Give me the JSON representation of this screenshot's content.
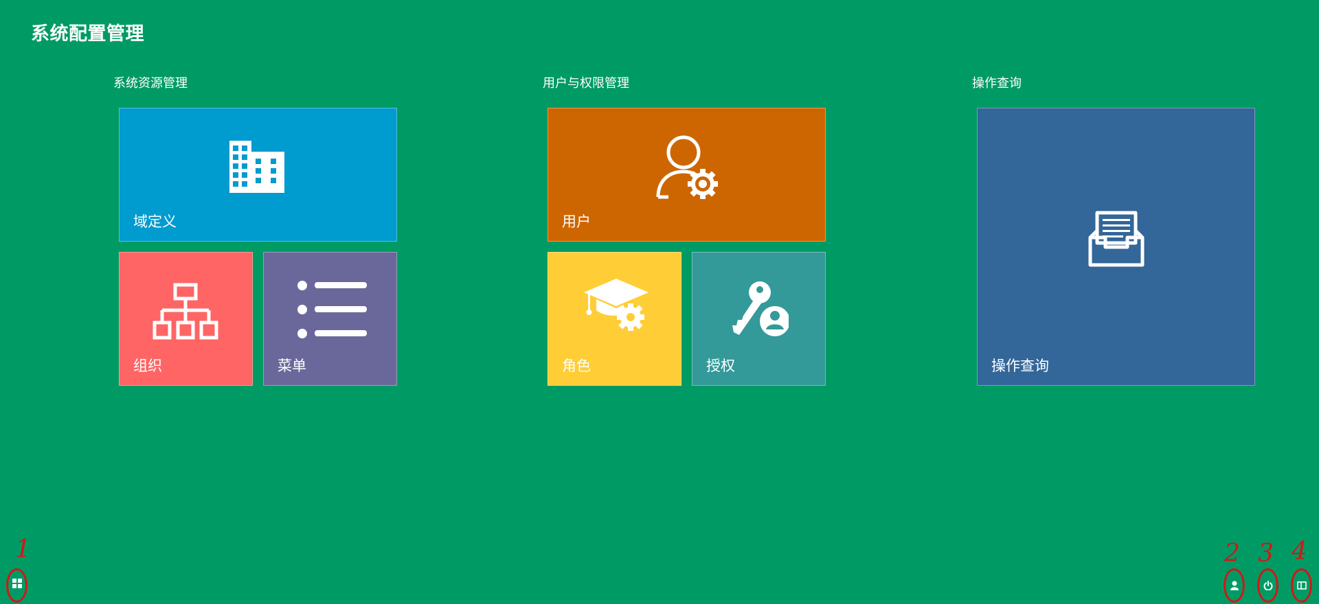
{
  "page": {
    "title": "系统配置管理",
    "background_color": "#009b64"
  },
  "groups": [
    {
      "title": "系统资源管理",
      "tiles": [
        {
          "label": "域定义",
          "icon": "building-icon",
          "color": "#009bcf"
        },
        {
          "label": "组织",
          "icon": "org-chart-icon",
          "color": "#ff6565"
        },
        {
          "label": "菜单",
          "icon": "list-icon",
          "color": "#6a689a"
        }
      ]
    },
    {
      "title": "用户与权限管理",
      "tiles": [
        {
          "label": "用户",
          "icon": "user-settings-icon",
          "color": "#cd6600"
        },
        {
          "label": "角色",
          "icon": "graduation-cap-gear-icon",
          "color": "#ffcd35"
        },
        {
          "label": "授权",
          "icon": "key-user-icon",
          "color": "#339999"
        }
      ]
    },
    {
      "title": "操作查询",
      "tiles": [
        {
          "label": "操作查询",
          "icon": "inbox-tray-icon",
          "color": "#336699"
        }
      ]
    }
  ],
  "taskbar": {
    "items": [
      {
        "icon": "start-menu-icon",
        "marker": "1"
      },
      {
        "icon": "user-icon",
        "marker": "2"
      },
      {
        "icon": "power-icon",
        "marker": "3"
      },
      {
        "icon": "window-icon",
        "marker": "4"
      }
    ],
    "marker_color": "#d01818"
  }
}
